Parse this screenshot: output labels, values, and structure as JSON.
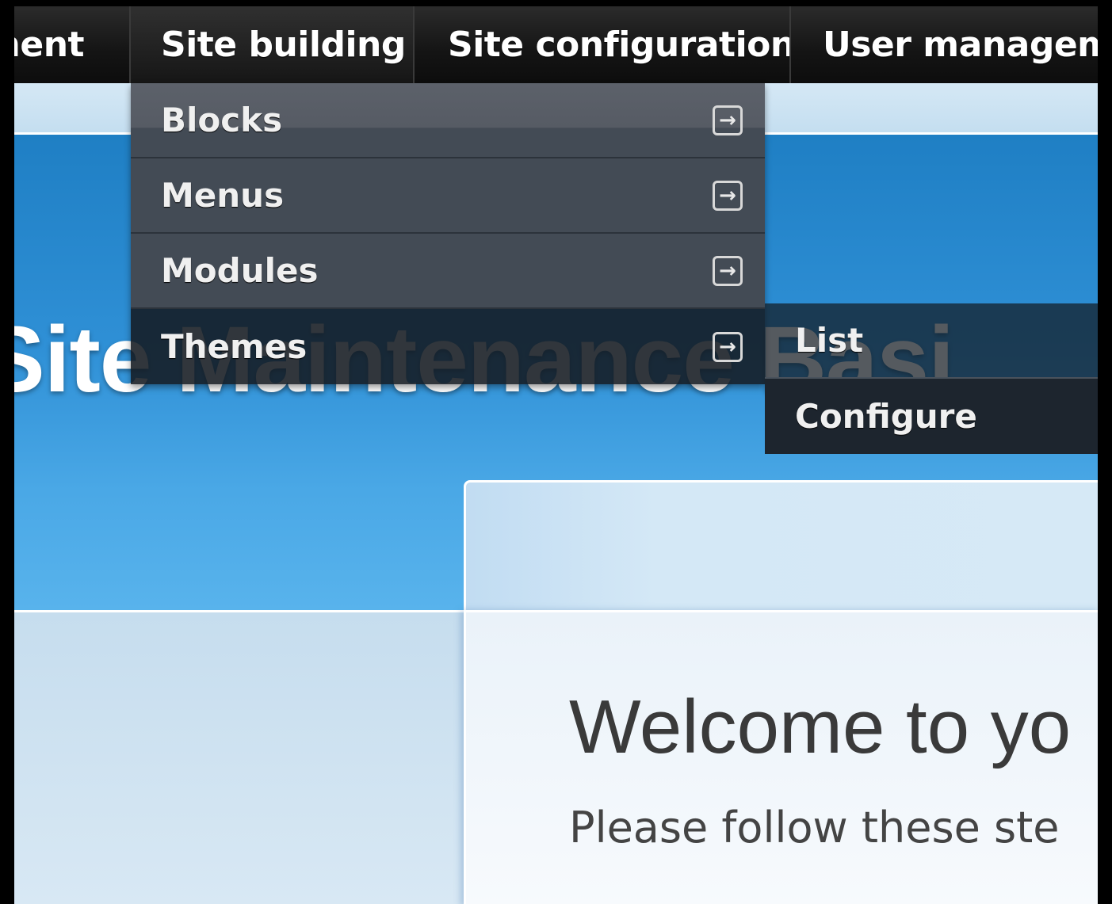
{
  "admin_menu": {
    "items": [
      {
        "label": "ment"
      },
      {
        "label": "Site building"
      },
      {
        "label": "Site configuration"
      },
      {
        "label": "User manageme"
      }
    ]
  },
  "dropdown": {
    "items": [
      {
        "label": "Blocks",
        "icon": "arrow-right-box-icon"
      },
      {
        "label": "Menus",
        "icon": "arrow-right-box-icon"
      },
      {
        "label": "Modules",
        "icon": "arrow-right-box-icon"
      },
      {
        "label": "Themes",
        "icon": "arrow-right-box-icon"
      }
    ],
    "arrow_glyph": "→"
  },
  "submenu": {
    "items": [
      {
        "label": "List"
      },
      {
        "label": "Configure"
      }
    ]
  },
  "header": {
    "site_title": "Site Maintenance Basi"
  },
  "content": {
    "welcome_heading": "Welcome to yo",
    "welcome_text": "Please follow these ste"
  },
  "colors": {
    "menu_bar": "#141414",
    "dropdown_bg": "#434b55",
    "header_blue": "#2f90d6",
    "page_bg": "#cfe3f1"
  }
}
